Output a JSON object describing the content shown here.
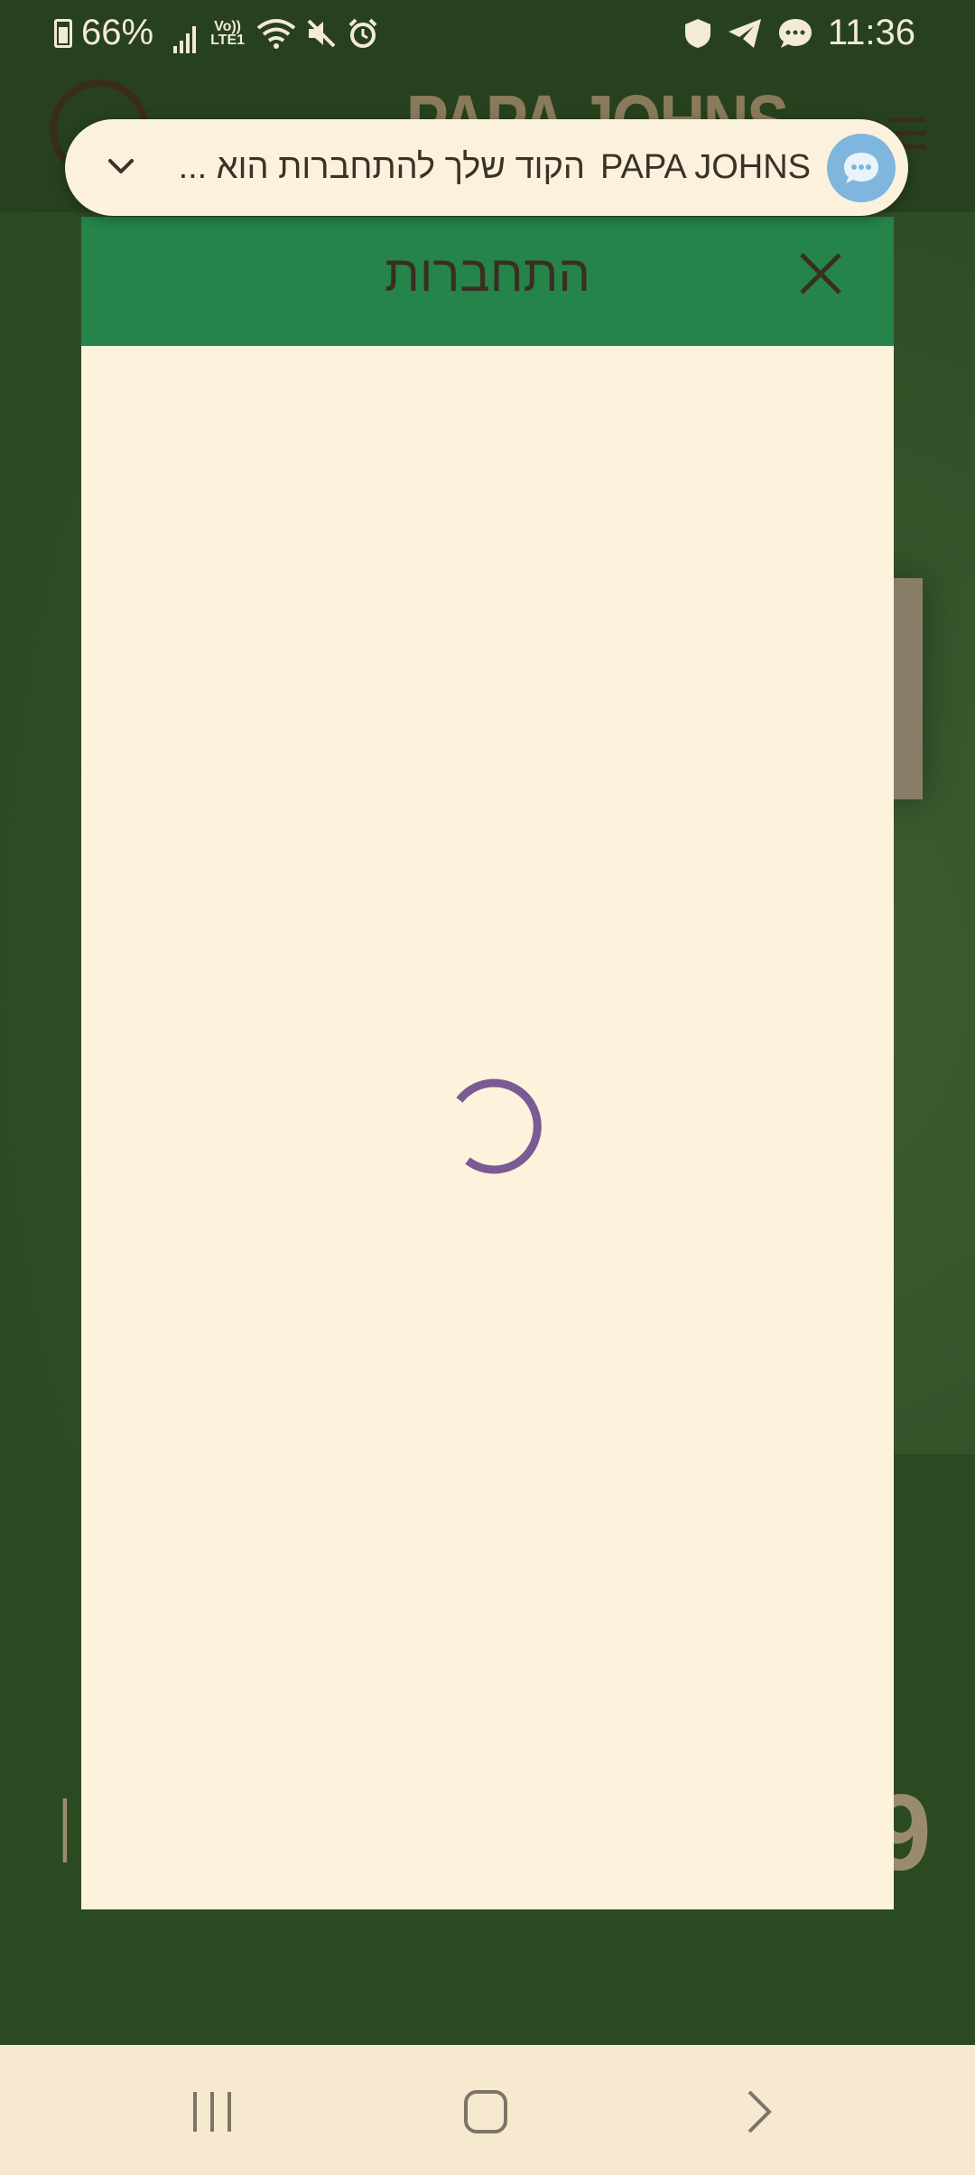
{
  "status_bar": {
    "battery": "66%",
    "network": "Vo)) LTE1",
    "time": "11:36"
  },
  "background": {
    "logo_text": "PAPA JOHNS",
    "left_fragment": "׀׀",
    "right_fragment": "9"
  },
  "notification": {
    "app_name": "PAPA JOHNS",
    "message": "הקוד שלך להתחברות הוא ...",
    "icon": "chat-bubble-icon"
  },
  "dialog": {
    "title": "התחברות",
    "close_icon": "close-icon",
    "loading": true,
    "spinner_color": "#7b5b94"
  },
  "nav_bar": {
    "recents": "recents-icon",
    "home": "home-icon",
    "back": "back-icon"
  },
  "colors": {
    "dialog_header": "#25844a",
    "dialog_body": "#fdf2dc",
    "backdrop": "#2e4d25",
    "notification_bg": "#fbf1dd",
    "notification_icon": "#7eb6dd"
  }
}
